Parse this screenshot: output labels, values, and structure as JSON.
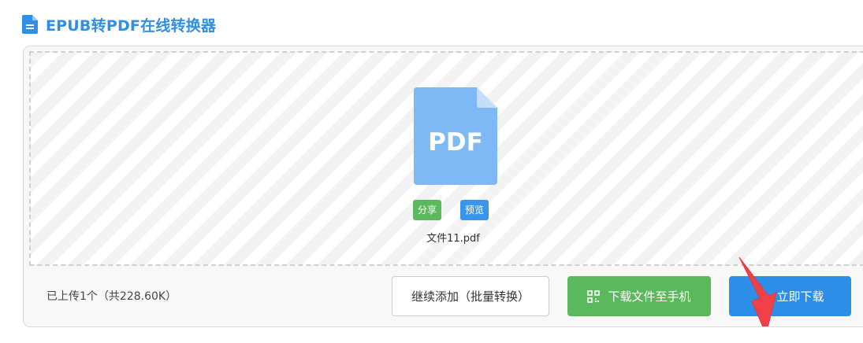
{
  "header": {
    "title": "EPUB转PDF在线转换器",
    "icon": "document-icon"
  },
  "file": {
    "type_label": "PDF",
    "name": "文件11.pdf",
    "share_label": "分享",
    "preview_label": "预览"
  },
  "status": {
    "text": "已上传1个（共228.60K）"
  },
  "actions": {
    "continue_label": "继续添加（批量转换）",
    "mobile_label": "下载文件至手机",
    "mobile_icon": "qr-code-icon",
    "download_label": "立即下载",
    "download_icon": "download-icon"
  },
  "colors": {
    "accent_blue": "#2d8ee8",
    "title_blue": "#2f8ee5",
    "green": "#5cb85c",
    "file_icon_blue": "#7fb9f5",
    "annotation_red": "#f0404a"
  }
}
